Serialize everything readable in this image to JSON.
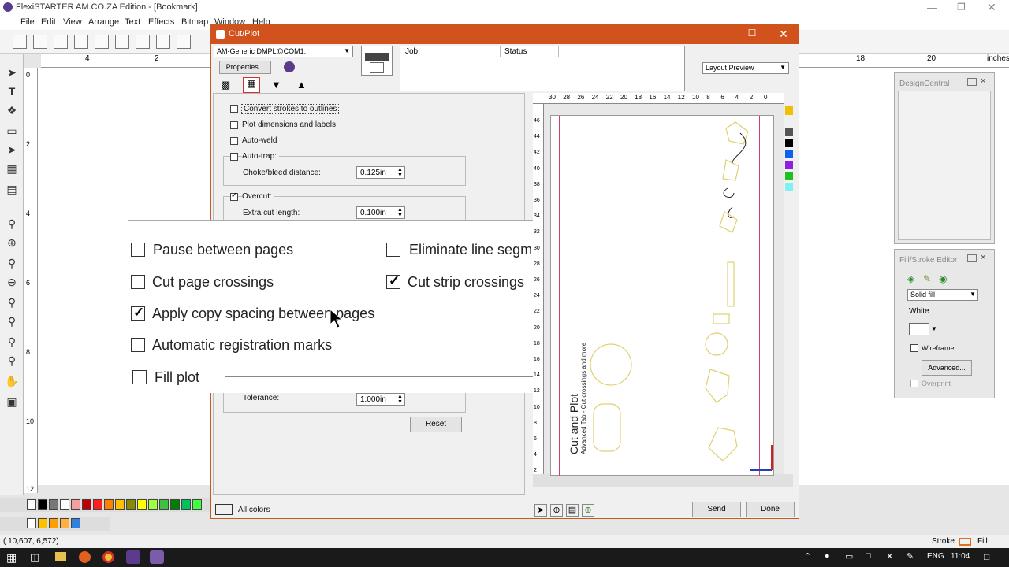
{
  "app": {
    "title": "FlexiSTARTER AM.CO.ZA Edition - [Bookmark]"
  },
  "menu": [
    "File",
    "Edit",
    "View",
    "Arrange",
    "Text",
    "Effects",
    "Bitmap",
    "Window",
    "Help"
  ],
  "ruler_top_labels": [
    "4",
    "2",
    "18",
    "20",
    "inches"
  ],
  "ruler_left_labels": [
    "0",
    "2",
    "4",
    "6",
    "8",
    "10",
    "12"
  ],
  "dialog": {
    "title": "Cut/Plot",
    "device": "AM-Generic DMPL@COM1:",
    "properties_label": "Properties...",
    "job_col": "Job",
    "status_col": "Status",
    "preview_select": "Layout Preview",
    "opts": {
      "convert": "Convert strokes to outlines",
      "plot_dims": "Plot dimensions and labels",
      "autoweld": "Auto-weld",
      "autotrap": "Auto-trap:",
      "choke": "Choke/bleed distance:",
      "choke_val": "0.125in",
      "overcut": "Overcut:",
      "extra": "Extra cut length:",
      "extra_val": "0.100in",
      "tolerance": "Tolerance:",
      "tolerance_val": "1.000in",
      "reset": "Reset"
    },
    "zoom": {
      "pause": "Pause between pages",
      "eliminate": "Eliminate line segme",
      "cutpage": "Cut page crossings",
      "cutstrip": "Cut strip crossings",
      "apply": "Apply copy spacing between pages",
      "autoreg": "Automatic registration marks",
      "fill": "Fill plot"
    },
    "preview_ruler_top": [
      "30",
      "28",
      "26",
      "24",
      "22",
      "20",
      "18",
      "16",
      "14",
      "12",
      "10",
      "8",
      "6",
      "4",
      "2",
      "0"
    ],
    "preview_ruler_left": [
      "46",
      "44",
      "42",
      "40",
      "38",
      "36",
      "34",
      "32",
      "30",
      "28",
      "26",
      "24",
      "22",
      "20",
      "18",
      "16",
      "14",
      "12",
      "10",
      "8",
      "6",
      "4",
      "2"
    ],
    "preview_text1": "Cut and Plot",
    "preview_text2": "Advanced Tab - Cut crossings and more",
    "all_colors": "All colors",
    "send": "Send",
    "done": "Done"
  },
  "design_central": {
    "title": "DesignCentral"
  },
  "fill_stroke": {
    "title": "Fill/Stroke Editor",
    "fill_type": "Solid fill",
    "color_name": "White",
    "wireframe": "Wireframe",
    "advanced": "Advanced...",
    "overprint": "Overprint"
  },
  "status": {
    "coords": "( 10,607,      6,572)",
    "stroke": "Stroke",
    "fill": "Fill"
  },
  "taskbar": {
    "lang": "ENG",
    "time": "11:04"
  },
  "colors": {
    "accent": "#d2521e"
  }
}
